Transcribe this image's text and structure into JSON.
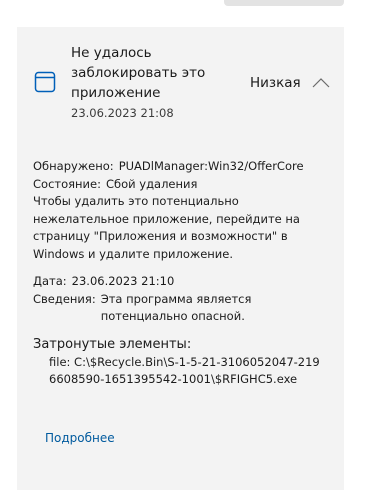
{
  "threat": {
    "title": "Не удалось заблокировать это приложение",
    "date": "23.06.2023 21:08",
    "severity": "Низкая"
  },
  "details": {
    "detected_label": "Обнаружено:",
    "detected_value": "PUADlManager:Win32/OfferCore",
    "status_label": "Состояние:",
    "status_value": "Сбой удаления",
    "instructions": "Чтобы удалить это потенциально нежелательное приложение, перейдите на страницу \"Приложения и возможности\" в Windows и удалите приложение.",
    "date_label": "Дата:",
    "date_value": "23.06.2023 21:10",
    "info_label": "Сведения:",
    "info_value": "Эта программа является потенциально опасной."
  },
  "affected": {
    "title": "Затронутые элементы:",
    "items": [
      "file: C:\\$Recycle.Bin\\S-1-5-21-3106052047-2196608590-1651395542-1001\\$RFIGHC5.exe"
    ]
  },
  "learn_more": "Подробнее",
  "colors": {
    "card_background": "#f3f3f3",
    "link": "#005a9e",
    "icon": "#005fb8"
  },
  "icons": {
    "app": "app-window-icon",
    "collapse": "chevron-up-icon"
  }
}
